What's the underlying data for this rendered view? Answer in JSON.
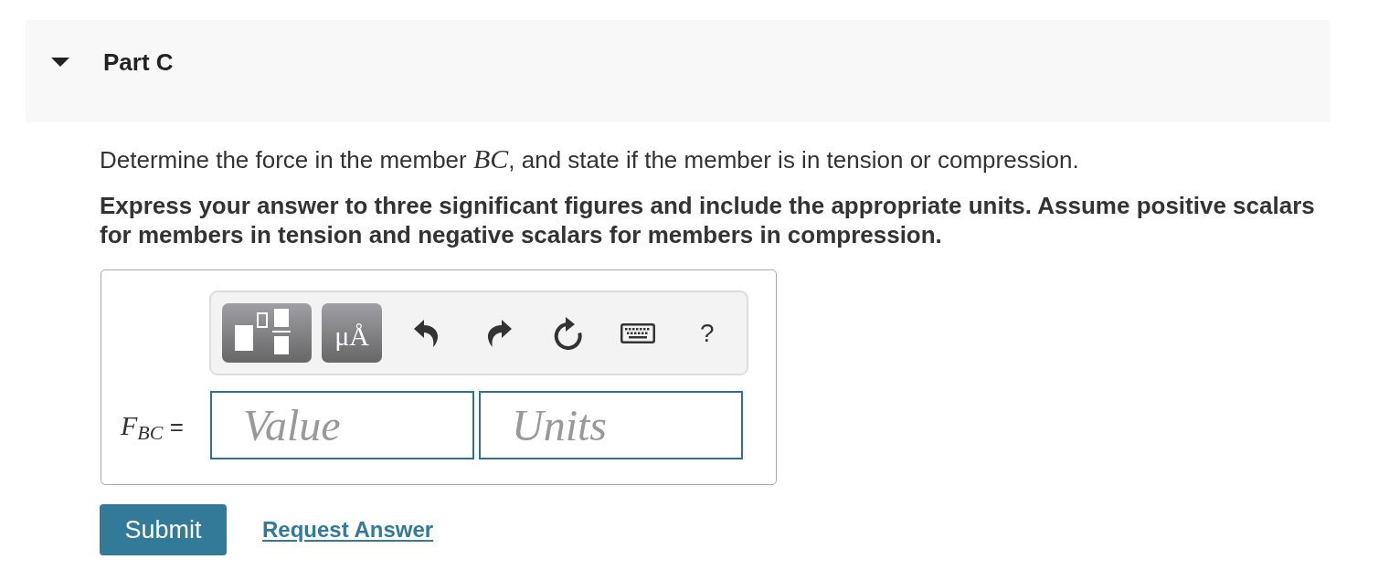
{
  "part": {
    "title": "Part C",
    "expanded": true
  },
  "question": "Determine the force in the member *BC*, and state if the member is in tension or compression.",
  "instructions": "Express your answer to three significant figures and include the appropriate units. Assume positive scalars for members in tension and negative scalars for members in compression.",
  "answer": {
    "toolbar": [
      {
        "kind": "templates"
      },
      {
        "kind": "units",
        "label": "μÅ"
      },
      {
        "kind": "undo"
      },
      {
        "kind": "redo"
      },
      {
        "kind": "reset"
      },
      {
        "kind": "keyboard"
      },
      {
        "kind": "help",
        "label": "?"
      }
    ],
    "label": "*F*$_{BC}$ =",
    "value_field": {
      "placeholder": "Value"
    },
    "units_field": {
      "placeholder": "Units"
    }
  },
  "actions": [
    {
      "kind": "button",
      "label": "Submit"
    },
    {
      "kind": "link",
      "label": "Request Answer"
    }
  ]
}
